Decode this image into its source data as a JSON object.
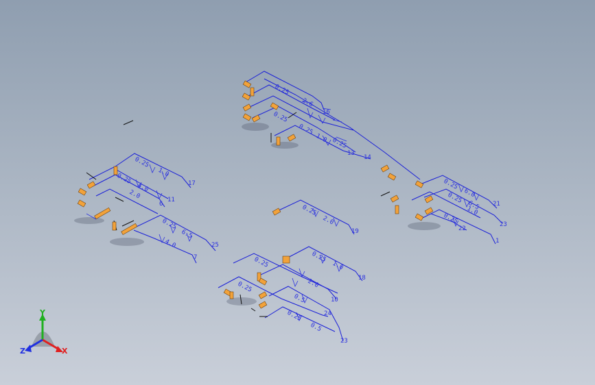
{
  "colors": {
    "background_top": "#8f9eb0",
    "background_bottom": "#c9cfd9",
    "pipe": "#1a1fd8",
    "fitting": "#f2a23a",
    "axis_x": "#e02020",
    "axis_y": "#20b020",
    "axis_z": "#2030e0"
  },
  "triad": {
    "x_label": "X",
    "y_label": "Y",
    "z_label": "Z"
  },
  "labels": {
    "g1": [
      "0.25",
      "1.0",
      "0.25",
      "4.0",
      "2.0",
      "17",
      "11",
      "6"
    ],
    "g2": [
      "0.25",
      "6.5",
      "4.0",
      "25",
      "7"
    ],
    "g3": [
      "0.25",
      "2.0",
      "19"
    ],
    "g4": [
      "0.25",
      "2.6",
      "0.25",
      "16",
      "0.25",
      "1.0",
      "0.25",
      "13",
      "14"
    ],
    "g5": [
      "0.25",
      "6.0",
      "0.25",
      "6.5",
      "0.25",
      "1.0",
      "22",
      "21",
      "23",
      "1"
    ],
    "g6": [
      "0.25",
      "1.0",
      "0.25",
      "2.0",
      "0.25",
      "0.5",
      "0.25",
      "0.5",
      "18",
      "10",
      "24",
      "23"
    ]
  }
}
